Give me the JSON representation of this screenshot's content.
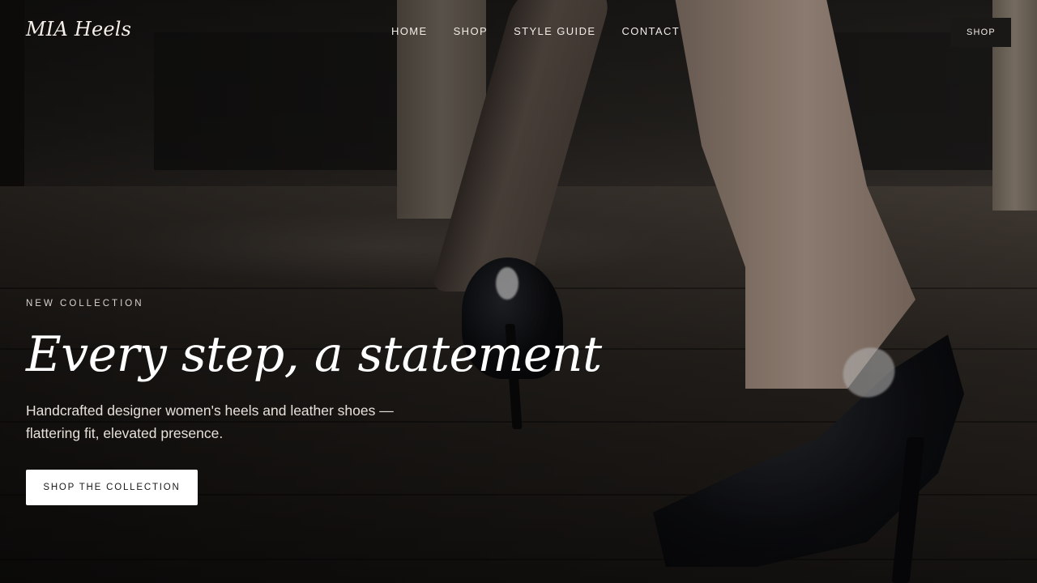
{
  "header": {
    "logo": "MIA Heels",
    "nav": {
      "home": "HOME",
      "shop": "SHOP",
      "style_guide": "STYLE GUIDE",
      "contact": "CONTACT"
    },
    "shop_button": "SHOP"
  },
  "hero": {
    "eyebrow": "NEW COLLECTION",
    "headline": "Every step, a statement",
    "subheadline": "Handcrafted designer women's heels and leather shoes — flattering fit, elevated presence.",
    "cta_label": "SHOP THE COLLECTION",
    "background_image": "woman-walking-in-black-patent-heels-photo"
  },
  "colors": {
    "text_light": "#ffffff",
    "button_dark": "#1a1817",
    "button_light": "#ffffff"
  }
}
